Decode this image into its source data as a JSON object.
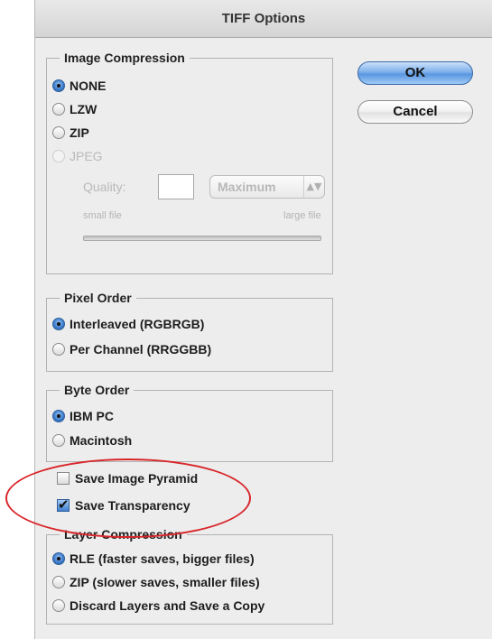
{
  "dialog": {
    "title": "TIFF Options"
  },
  "buttons": {
    "ok": "OK",
    "cancel": "Cancel"
  },
  "image_compression": {
    "legend": "Image Compression",
    "options": [
      "NONE",
      "LZW",
      "ZIP",
      "JPEG"
    ],
    "selected": "NONE",
    "quality_label": "Quality:",
    "quality_value": "",
    "quality_preset": "Maximum",
    "small_file": "small file",
    "large_file": "large file"
  },
  "pixel_order": {
    "legend": "Pixel Order",
    "options": [
      "Interleaved (RGBRGB)",
      "Per Channel (RRGGBB)"
    ],
    "selected": "Interleaved (RGBRGB)"
  },
  "byte_order": {
    "legend": "Byte Order",
    "options": [
      "IBM PC",
      "Macintosh"
    ],
    "selected": "IBM PC"
  },
  "checkboxes": {
    "save_image_pyramid": {
      "label": "Save Image Pyramid",
      "checked": false
    },
    "save_transparency": {
      "label": "Save Transparency",
      "checked": true
    }
  },
  "layer_compression": {
    "legend": "Layer Compression",
    "options": [
      "RLE (faster saves, bigger files)",
      "ZIP (slower saves, smaller files)",
      "Discard Layers and Save a Copy"
    ],
    "selected": "RLE (faster saves, bigger files)"
  },
  "annotation": {
    "color": "#d8262a"
  },
  "colors": {
    "accent": "#3f7fcf",
    "window_bg": "#ededed"
  }
}
